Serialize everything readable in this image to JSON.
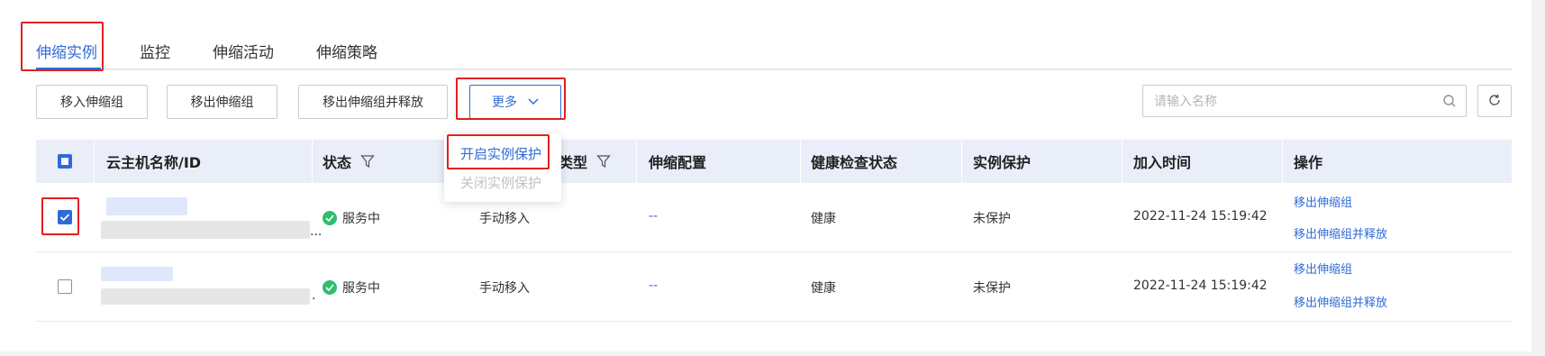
{
  "tabs": [
    {
      "label": "伸缩实例",
      "active": true
    },
    {
      "label": "监控",
      "active": false
    },
    {
      "label": "伸缩活动",
      "active": false
    },
    {
      "label": "伸缩策略",
      "active": false
    }
  ],
  "toolbar": {
    "move_in": "移入伸缩组",
    "move_out": "移出伸缩组",
    "move_out_release": "移出伸缩组并释放",
    "more": "更多",
    "search_placeholder": "请输入名称"
  },
  "more_menu": [
    {
      "label": "开启实例保护",
      "disabled": false,
      "highlighted": true
    },
    {
      "label": "关闭实例保护",
      "disabled": true,
      "highlighted": false
    }
  ],
  "columns": {
    "name": "云主机名称/ID",
    "status": "状态",
    "type": "类型",
    "config": "伸缩配置",
    "health": "健康检查状态",
    "protection": "实例保护",
    "join_time": "加入时间",
    "actions": "操作"
  },
  "rows": [
    {
      "checked": true,
      "name_suffix": "...",
      "status": "服务中",
      "type": "手动移入",
      "config": "--",
      "health": "健康",
      "protection": "未保护",
      "join_time": "2022-11-24 15:19:42",
      "actions": [
        "移出伸缩组",
        "移出伸缩组并释放"
      ]
    },
    {
      "checked": false,
      "name_suffix": ".",
      "status": "服务中",
      "type": "手动移入",
      "config": "--",
      "health": "健康",
      "protection": "未保护",
      "join_time": "2022-11-24 15:19:42",
      "actions": [
        "移出伸缩组",
        "移出伸缩组并释放"
      ]
    }
  ],
  "colors": {
    "accent": "#2f6bd8",
    "highlight_box": "#e02020",
    "status_ok": "#2fbf6c",
    "header_bg": "#e9eef8"
  },
  "icons": {
    "more_chevron": "chevron-down-icon",
    "search": "search-icon",
    "refresh": "refresh-icon",
    "filter": "filter-icon",
    "status": "check-circle-icon"
  }
}
